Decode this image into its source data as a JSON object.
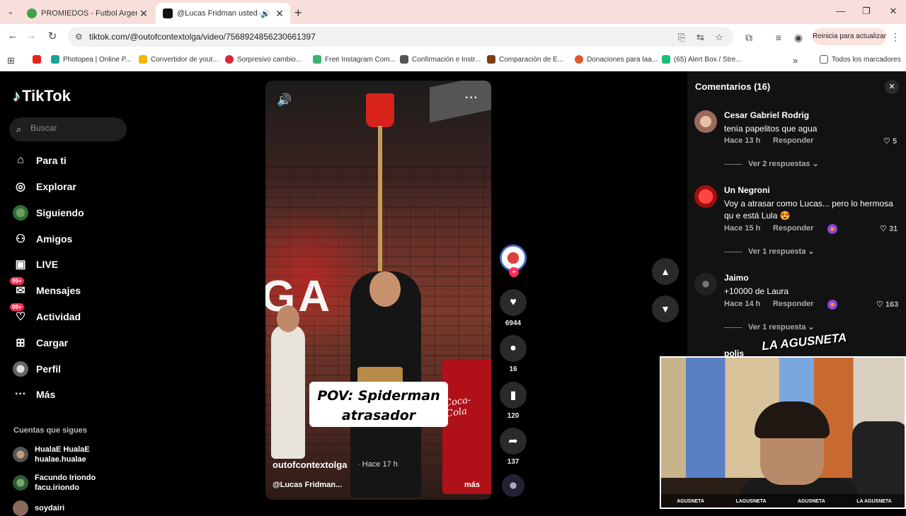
{
  "browser": {
    "tabs": [
      {
        "title": "PROMIEDOS - Futbol Argentino",
        "active": false,
        "favicon_color": "#3fa34d"
      },
      {
        "title": "@Lucas Fridman usted es u",
        "active": true,
        "favicon_color": "#111111"
      }
    ],
    "url": "tiktok.com/@outofcontextolga/video/7568924856230661397",
    "update_button": "Reinicia para actualizar",
    "bookmarks": [
      {
        "label": "",
        "color": "#e62117"
      },
      {
        "label": "Photopea | Online P...",
        "color": "#18a497"
      },
      {
        "label": "Convertidor de yout...",
        "color": "#f2b705"
      },
      {
        "label": "Sorpresivo cambio...",
        "color": "#d8243c"
      },
      {
        "label": "Free Instagram Com...",
        "color": "#3cb371"
      },
      {
        "label": "Confirmación e Instr...",
        "color": "#555555"
      },
      {
        "label": "Comparación de E...",
        "color": "#7a3e12"
      },
      {
        "label": "Donaciones para laa...",
        "color": "#e8552a"
      },
      {
        "label": "(65) Alert Box / Stre...",
        "color": "#1bbf7a"
      }
    ],
    "bookmarks_more": "»",
    "all_bookmarks": "Todos los marcadores"
  },
  "tiktok": {
    "logo": "TikTok",
    "search_placeholder": "Buscar",
    "nav": [
      {
        "label": "Para ti",
        "icon": "home-icon",
        "glyph": "⌂"
      },
      {
        "label": "Explorar",
        "icon": "compass-icon",
        "glyph": "◎"
      },
      {
        "label": "Siguiendo",
        "icon": "following-avatar-icon",
        "glyph": ""
      },
      {
        "label": "Amigos",
        "icon": "friends-icon",
        "glyph": "⚇"
      },
      {
        "label": "LIVE",
        "icon": "live-tv-icon",
        "glyph": "▣"
      },
      {
        "label": "Mensajes",
        "icon": "messages-icon",
        "glyph": "✉",
        "badge": "99+"
      },
      {
        "label": "Actividad",
        "icon": "activity-icon",
        "glyph": "♡",
        "badge": "99+"
      },
      {
        "label": "Cargar",
        "icon": "upload-icon",
        "glyph": "⊞"
      },
      {
        "label": "Perfil",
        "icon": "profile-avatar-icon",
        "glyph": ""
      },
      {
        "label": "Más",
        "icon": "more-icon",
        "glyph": "···"
      }
    ],
    "following_title": "Cuentas que sigues",
    "following": [
      {
        "name": "HualaE HualaE",
        "handle": "hualae.hualae"
      },
      {
        "name": "Facundo Iriondo",
        "handle": "facu.iriondo"
      },
      {
        "name": "soydairi",
        "handle": ""
      }
    ]
  },
  "video": {
    "caption_line1": "POV: Spiderman",
    "caption_line2": "atrasador",
    "author": "outofcontextolga",
    "posted": "· Hace 17 h",
    "music": "@Lucas Fridman...",
    "more": "más",
    "overlay_letters": "GA",
    "fridge_text": "Coca-Cola",
    "likes": "6944",
    "comments": "16",
    "saves": "120",
    "shares": "137"
  },
  "comments_panel": {
    "title": "Comentarios (16)",
    "comments": [
      {
        "name": "Cesar Gabriel Rodrig",
        "text": "tenía papelitos que agua",
        "time": "Hace 13 h",
        "reply": "Responder",
        "likes": "5",
        "replies": "Ver 2 respuestas",
        "avatar_color": "#c9a08a"
      },
      {
        "name": "Un Negroni",
        "text": "Voy a atrasar como Lucas... pero lo hermosa qu e está Lula 😍",
        "time": "Hace 15 h",
        "reply": "Responder",
        "likes": "31",
        "replies": "Ver 1 respuesta",
        "avatar_color": "#d81e1e"
      },
      {
        "name": "Jaimo",
        "text": "+10000 de Laura",
        "time": "Hace 14 h",
        "reply": "Responder",
        "likes": "163",
        "replies": "Ver 1 respuesta",
        "avatar_color": "#333333"
      }
    ],
    "partial_name": "polis"
  },
  "stream_overlay": {
    "brand": "LA AGUSNETA",
    "socials": [
      "AGUSNETA",
      "LAGUSNETA",
      "AGUSNETA",
      "LA AGUSNETA"
    ]
  }
}
